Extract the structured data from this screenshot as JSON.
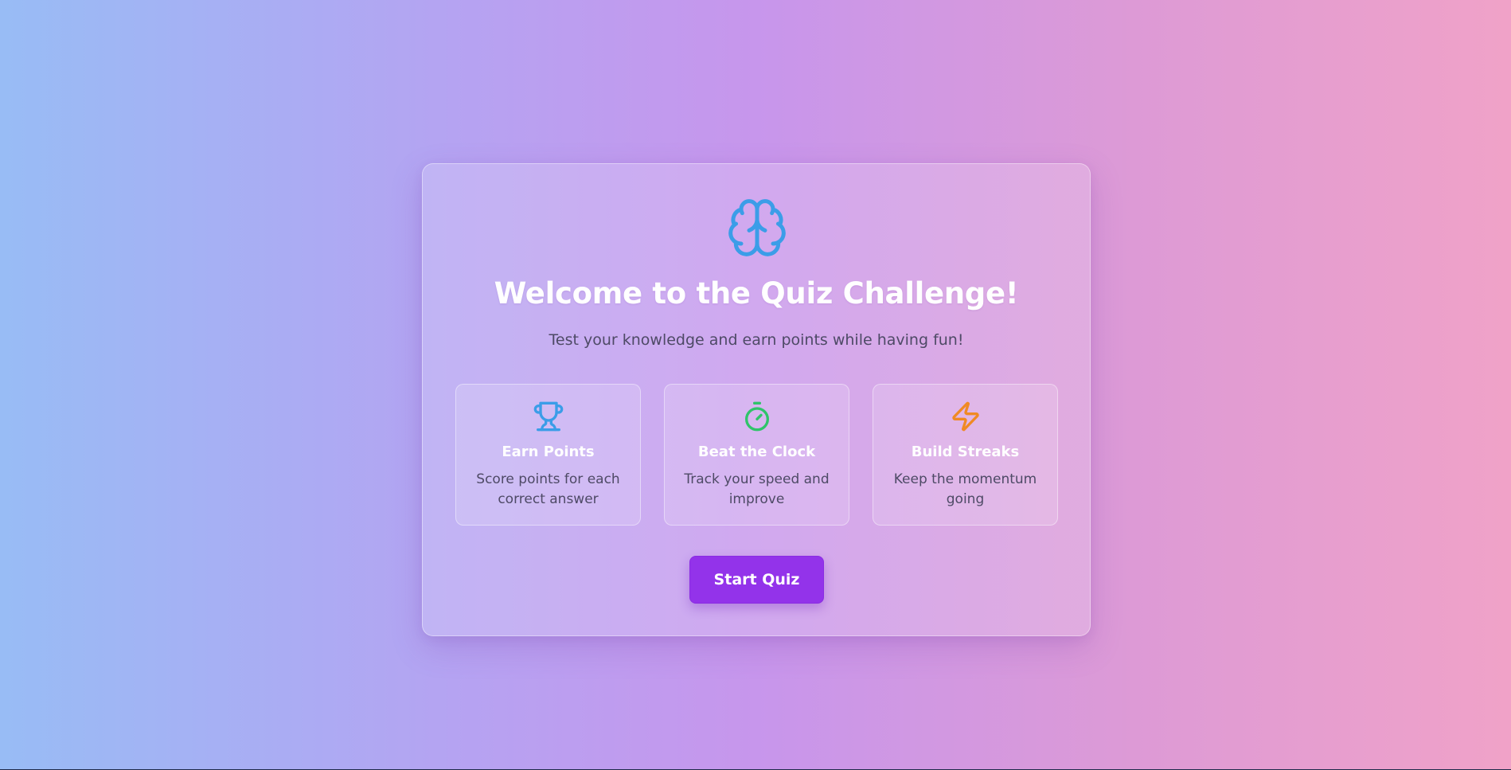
{
  "welcome": {
    "title": "Welcome to the Quiz Challenge!",
    "subtitle": "Test your knowledge and earn points while having fun!",
    "icon": "brain-icon"
  },
  "features": [
    {
      "icon": "trophy-icon",
      "title": "Earn Points",
      "description": "Score points for each correct answer",
      "color": "#3b9de8"
    },
    {
      "icon": "timer-icon",
      "title": "Beat the Clock",
      "description": "Track your speed and improve",
      "color": "#2fc46a"
    },
    {
      "icon": "zap-icon",
      "title": "Build Streaks",
      "description": "Keep the momentum going",
      "color": "#f08a24"
    }
  ],
  "start_button": {
    "label": "Start Quiz"
  },
  "colors": {
    "accent": "#9333ea",
    "brain_icon": "#3b9de8",
    "background_left": "#98bcf5",
    "background_right": "#f0a2c8"
  }
}
